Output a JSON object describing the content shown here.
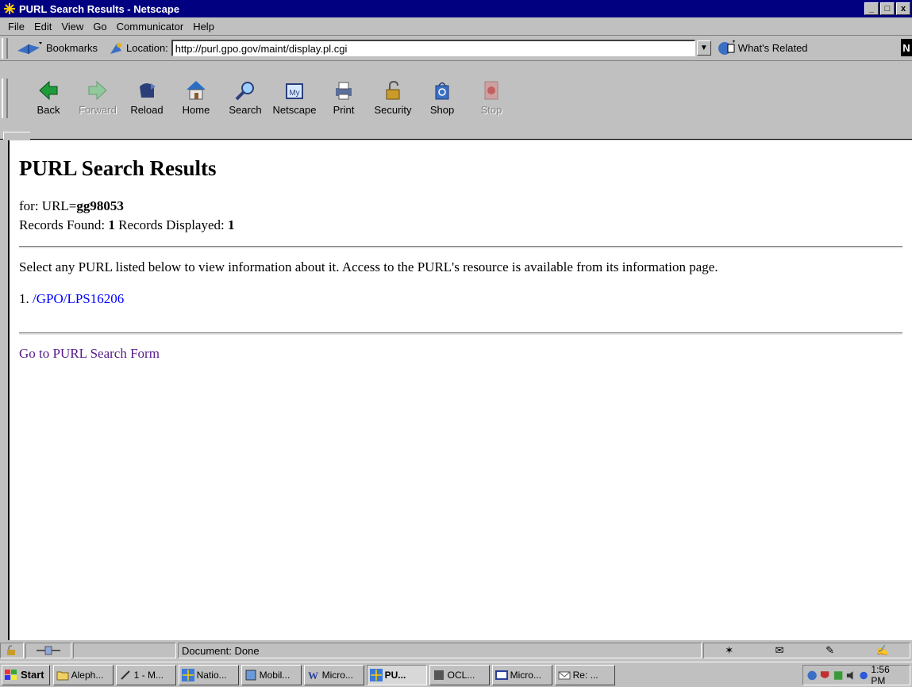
{
  "window": {
    "title": "PURL Search Results - Netscape",
    "controls": [
      "_",
      "□",
      "x"
    ]
  },
  "menu": [
    "File",
    "Edit",
    "View",
    "Go",
    "Communicator",
    "Help"
  ],
  "location_bar": {
    "bookmarks_label": "Bookmarks",
    "location_label": "Location:",
    "url": "http://purl.gpo.gov/maint/display.pl.cgi",
    "whats_related_label": "What's Related"
  },
  "toolbar": {
    "buttons": [
      {
        "label": "Back",
        "icon": "back-arrow-icon",
        "enabled": true
      },
      {
        "label": "Forward",
        "icon": "forward-arrow-icon",
        "enabled": false
      },
      {
        "label": "Reload",
        "icon": "reload-icon",
        "enabled": true
      },
      {
        "label": "Home",
        "icon": "home-icon",
        "enabled": true
      },
      {
        "label": "Search",
        "icon": "search-icon",
        "enabled": true
      },
      {
        "label": "Netscape",
        "icon": "netscape-icon",
        "enabled": true
      },
      {
        "label": "Print",
        "icon": "print-icon",
        "enabled": true
      },
      {
        "label": "Security",
        "icon": "security-lock-icon",
        "enabled": true
      },
      {
        "label": "Shop",
        "icon": "shop-bag-icon",
        "enabled": true
      },
      {
        "label": "Stop",
        "icon": "stop-icon",
        "enabled": false
      }
    ]
  },
  "page": {
    "heading": "PURL Search Results",
    "for_label": "for: URL=",
    "query": "gg98053",
    "records_found_label": "Records Found: ",
    "records_found": "1",
    "records_displayed_label": " Records Displayed: ",
    "records_displayed": "1",
    "instructions": "Select any PURL listed below to view information about it. Access to the PURL's resource is available from its information page.",
    "results": [
      {
        "number": "1. ",
        "purl": "/GPO/LPS16206"
      }
    ],
    "search_form_link": "Go to PURL Search Form"
  },
  "status": {
    "text": "Document: Done"
  },
  "taskbar": {
    "start_label": "Start",
    "tasks": [
      {
        "label": "Aleph...",
        "icon": "folder-icon",
        "active": false
      },
      {
        "label": "1 - M...",
        "icon": "pen-icon",
        "active": false
      },
      {
        "label": "Natio...",
        "icon": "netscape-icon",
        "active": false
      },
      {
        "label": "Mobil...",
        "icon": "puzzle-icon",
        "active": false
      },
      {
        "label": "Micro...",
        "icon": "word-icon",
        "active": false
      },
      {
        "label": "PU...",
        "icon": "netscape-icon",
        "active": true
      },
      {
        "label": "OCL...",
        "icon": "app-icon",
        "active": false
      },
      {
        "label": "Micro...",
        "icon": "window-icon",
        "active": false
      },
      {
        "label": "Re: ...",
        "icon": "mail-icon",
        "active": false
      }
    ],
    "clock": "1:56 PM"
  },
  "colors": {
    "title_bar": "#000080",
    "chrome": "#c0c0c0",
    "link": "#0000ff",
    "visited_link": "#551a8b"
  }
}
